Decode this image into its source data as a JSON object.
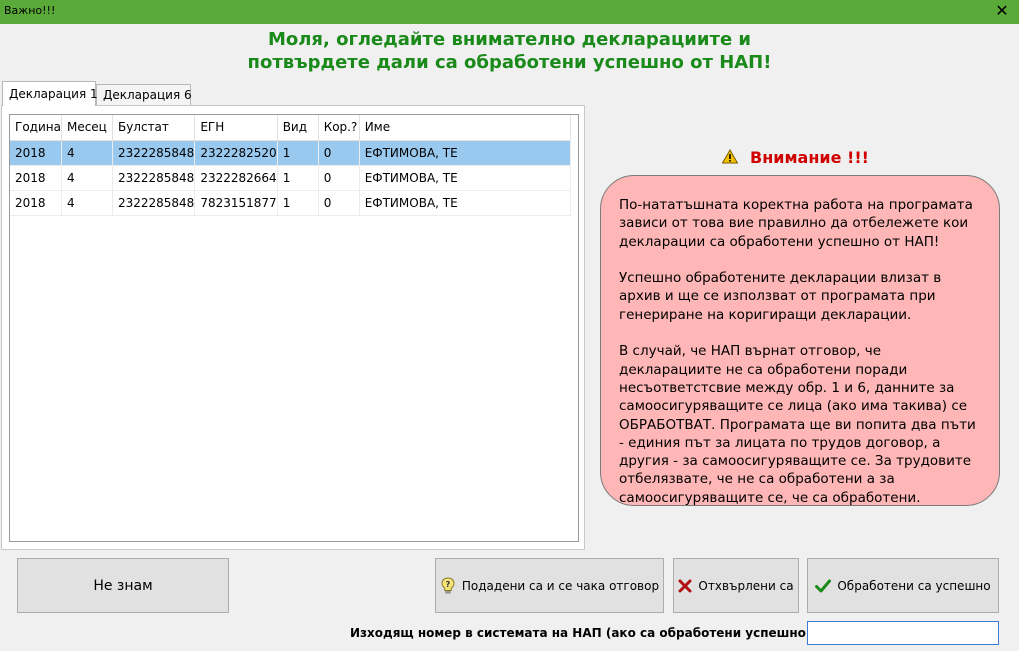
{
  "window": {
    "title": "Важно!!!",
    "close_glyph": "✕"
  },
  "heading": {
    "line1": "Моля, огледайте внимателно декларациите и",
    "line2": "потвърдете дали са обработени успешно от НАП!"
  },
  "tabs": [
    {
      "label": "Декларация 1",
      "active": true
    },
    {
      "label": "Декларация 6",
      "active": false
    }
  ],
  "table": {
    "columns": [
      "Година",
      "Месец",
      "Булстат",
      "ЕГН",
      "Вид",
      "Кор.?",
      "Име"
    ],
    "rows": [
      {
        "selected": true,
        "cells": [
          "2018",
          "4",
          "2322285848",
          "2322282520",
          "1",
          "0",
          "ЕФТИМОВА, ТЕ"
        ]
      },
      {
        "selected": false,
        "cells": [
          "2018",
          "4",
          "2322285848",
          "2322282664",
          "1",
          "0",
          "ЕФТИМОВА, ТЕ"
        ]
      },
      {
        "selected": false,
        "cells": [
          "2018",
          "4",
          "2322285848",
          "7823151877",
          "1",
          "0",
          "ЕФТИМОВА, ТЕ"
        ]
      }
    ],
    "selected_color": "#99c9ef"
  },
  "warning": {
    "title": "Внимание !!!",
    "icon": "warning-triangle-icon",
    "paragraphs": [
      "По-нататъшната коректна работа на програмата зависи от това вие правилно да отбележете кои декларации са обработени успешно от НАП!",
      "Успешно обработените декларации влизат в архив и ще се използват от програмата при генериране на коригиращи декларации.",
      "В случай, че НАП върнат отговор, че декларациите не са обработени поради несъответстсвие между обр. 1 и 6, данните за самоосигуряващите се лица (ако има такива) се ОБРАБОТВАТ. Програмата ще ви попита два пъти - единия път за лицата по трудов договор, а другия - за самоосигуряващите се. За трудовите отбелязвате, че не са обработени а за самоосигуряващите се, че са обработени."
    ],
    "box_color": "#ffb6b6"
  },
  "buttons": {
    "dont_know": "Не знам",
    "submitted": "Подадени са и се чака отговор",
    "rejected": "Отхвърлени са",
    "processed": "Обработени са успешно"
  },
  "reference": {
    "label": "Изходящ номер в системата на НАП (ако са обработени успешно):",
    "value": ""
  },
  "colors": {
    "titlebar": "#5aaa3a",
    "heading": "#1a8a1a",
    "warning_text": "#d00000"
  }
}
